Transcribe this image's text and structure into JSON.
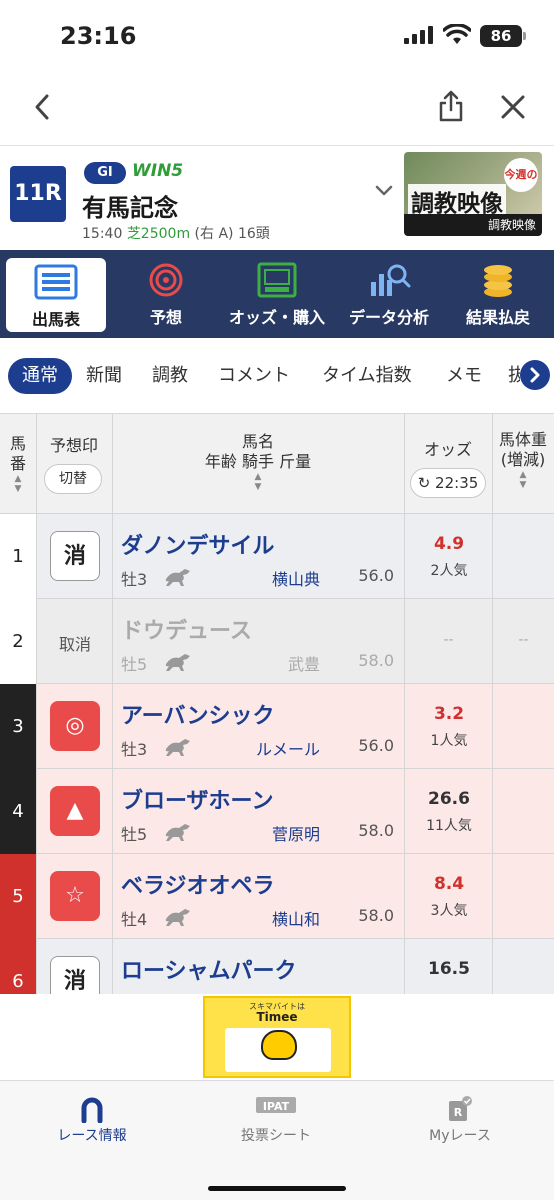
{
  "status_bar": {
    "time": "23:16",
    "battery": "86"
  },
  "race": {
    "number": "11R",
    "grade": "GI",
    "win5": "WIN5",
    "name": "有馬記念",
    "start_time": "15:40",
    "surface": "芝2500m",
    "course": "(右 A)",
    "runners": "16頭",
    "banner": {
      "badge": "今週の",
      "title": "調教映像",
      "caption": "調教映像"
    }
  },
  "menu": [
    {
      "label": "出馬表",
      "icon": "entry-table-icon",
      "active": true
    },
    {
      "label": "予想",
      "icon": "target-icon",
      "active": false
    },
    {
      "label": "オッズ・購入",
      "icon": "ipat-icon",
      "active": false
    },
    {
      "label": "データ分析",
      "icon": "chart-search-icon",
      "active": false
    },
    {
      "label": "結果払戻",
      "icon": "coins-icon",
      "active": false
    }
  ],
  "subtabs": [
    "通常",
    "新聞",
    "調教",
    "コメント",
    "タイム指数",
    "メモ",
    "抜"
  ],
  "table_header": {
    "num_line1": "馬",
    "num_line2": "番",
    "mark": "予想印",
    "toggle": "切替",
    "horse_line1": "馬名",
    "horse_line2": "年齢  騎手  斤量",
    "odds": "オッズ",
    "odds_time": "22:35",
    "weight_line1": "馬体重",
    "weight_line2": "(増減)"
  },
  "rows": [
    {
      "num": "1",
      "num_color": "#ffffff",
      "num_text_color": "#222222",
      "mark": "消",
      "mark_style": "kesu",
      "name": "ダノンデサイル",
      "sex_age": "牡3",
      "jockey": "横山典",
      "weight": "56.0",
      "odds": "4.9",
      "odds_hot": true,
      "popularity": "2人気",
      "row_bg": "#eceef2",
      "scratched": false
    },
    {
      "num": "2",
      "num_color": "#ffffff",
      "num_text_color": "#222222",
      "mark": "取消",
      "mark_style": "scratch",
      "name": "ドウデュース",
      "sex_age": "牡5",
      "jockey": "武豊",
      "weight": "58.0",
      "odds": "--",
      "odds_hot": false,
      "popularity": "",
      "row_bg": "#ececec",
      "scratched": true,
      "weight_change": "--"
    },
    {
      "num": "3",
      "num_color": "#222222",
      "num_text_color": "#ffffff",
      "mark": "◎",
      "mark_style": "red",
      "name": "アーバンシック",
      "sex_age": "牡3",
      "jockey": "ルメール",
      "weight": "56.0",
      "odds": "3.2",
      "odds_hot": true,
      "popularity": "1人気",
      "row_bg": "#fde8e8",
      "scratched": false
    },
    {
      "num": "4",
      "num_color": "#222222",
      "num_text_color": "#ffffff",
      "mark": "▲",
      "mark_style": "red",
      "name": "ブローザホーン",
      "sex_age": "牡5",
      "jockey": "菅原明",
      "weight": "58.0",
      "odds": "26.6",
      "odds_hot": false,
      "popularity": "11人気",
      "row_bg": "#fde8e8",
      "scratched": false
    },
    {
      "num": "5",
      "num_color": "#d0312d",
      "num_text_color": "#ffffff",
      "mark": "☆",
      "mark_style": "red",
      "name": "ベラジオオペラ",
      "sex_age": "牡4",
      "jockey": "横山和",
      "weight": "58.0",
      "odds": "8.4",
      "odds_hot": true,
      "popularity": "3人気",
      "row_bg": "#fde8e8",
      "scratched": false
    },
    {
      "num": "6",
      "num_color": "#d0312d",
      "num_text_color": "#ffffff",
      "mark": "消",
      "mark_style": "kesu",
      "name": "ローシャムパーク",
      "sex_age": "",
      "jockey": "",
      "weight": "",
      "odds": "16.5",
      "odds_hot": false,
      "popularity": "",
      "row_bg": "#eceef2",
      "scratched": false
    }
  ],
  "ad": {
    "small": "スキマバイトは",
    "brand": "Timee"
  },
  "tabbar": [
    {
      "label": "レース情報",
      "icon": "horseshoe-icon",
      "active": true
    },
    {
      "label": "投票シート",
      "icon": "ipat-card-icon",
      "active": false
    },
    {
      "label": "Myレース",
      "icon": "my-race-icon",
      "active": false
    }
  ],
  "colors": {
    "primary": "#1d3d8f",
    "menu_bg": "#283a63",
    "accent_red": "#e94b4b",
    "turf_green": "#2f9d3a"
  }
}
